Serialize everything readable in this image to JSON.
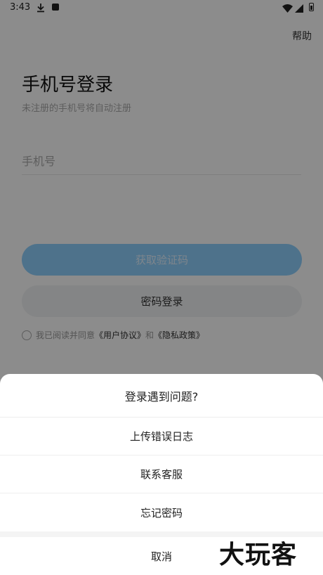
{
  "status_bar": {
    "time": "3:43"
  },
  "header": {
    "help_label": "帮助"
  },
  "login": {
    "title": "手机号登录",
    "subtitle": "未注册的手机号将自动注册",
    "phone_placeholder": "手机号",
    "get_code_label": "获取验证码",
    "password_login_label": "密码登录",
    "agreement_prefix": "我已阅读并同意",
    "user_agreement": "《用户协议》",
    "and": "和",
    "privacy_policy": "《隐私政策》"
  },
  "sheet": {
    "title": "登录遇到问题?",
    "items": [
      {
        "label": "上传错误日志"
      },
      {
        "label": "联系客服"
      },
      {
        "label": "忘记密码"
      }
    ],
    "cancel_label": "取消"
  },
  "watermark": {
    "text": "大玩客"
  },
  "colors": {
    "primary_button": "#8fd0fd",
    "secondary_button": "#f1f3f4",
    "overlay": "rgba(0,0,0,0.45)"
  },
  "icons": [
    "download-icon",
    "app-notification-icon",
    "wifi-icon",
    "signal-icon",
    "battery-icon"
  ]
}
